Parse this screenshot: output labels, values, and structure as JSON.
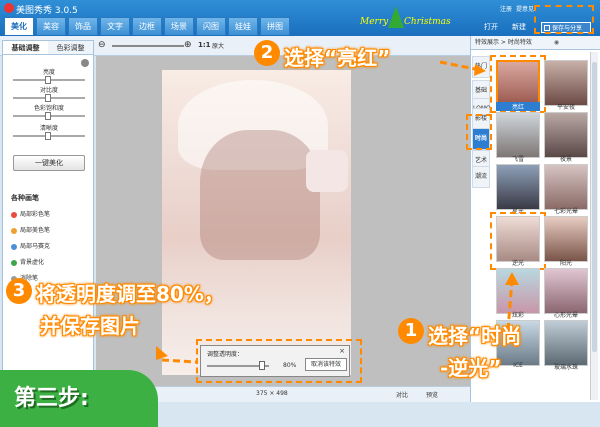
{
  "titlebar": {
    "app_title": "美图秀秀 3.0.5",
    "tabs": [
      "美化",
      "美容",
      "饰品",
      "文字",
      "边框",
      "场景",
      "闪图",
      "娃娃",
      "拼图"
    ],
    "active_tab": "美化",
    "holiday_text_1": "Merry",
    "holiday_text_2": "Christmas",
    "right_links": [
      "注册",
      "提意见"
    ],
    "open_label": "打开",
    "new_label": "新建",
    "save_label": "保存与分享"
  },
  "zoombar": {
    "ratio": "1:1",
    "original_label": "原大"
  },
  "left_panel": {
    "tabs": [
      "基础调整",
      "色彩调整"
    ],
    "sliders": [
      "亮度",
      "对比度",
      "色彩饱和度",
      "清晰度"
    ],
    "one_click": "一键美化",
    "brush_title": "各种画笔",
    "brushes": [
      {
        "label": "局部彩色笔",
        "color": "#e84a3c"
      },
      {
        "label": "局部美色笔",
        "color": "#f0a030"
      },
      {
        "label": "局部马赛克",
        "color": "#4a8fd8"
      },
      {
        "label": "背景虚化",
        "color": "#3aa84a"
      },
      {
        "label": "消除笔",
        "color": "#999999"
      }
    ]
  },
  "status_bar": {
    "size": "375 × 498",
    "compare": "对比",
    "preview": "预览"
  },
  "dialog": {
    "title": "调整透明度：",
    "percent": "80%",
    "cancel": "取消该特效",
    "close": "×"
  },
  "right_panel": {
    "header": "特效展示",
    "breadcrumb": "时尚特效",
    "categories": [
      "热门",
      "基础",
      "LOMO",
      "影楼",
      "时尚",
      "艺术",
      "潮流"
    ],
    "active_category": "时尚",
    "effects": [
      "亮红",
      "平安夜",
      "飞雪",
      "夜景",
      "星光",
      "七彩光晕",
      "逆光",
      "阳光",
      "炫彩",
      "心形光晕",
      "ICE",
      "玻璃水珠"
    ],
    "selected_effect": "亮红"
  },
  "callouts": {
    "step1_num": "1",
    "step1_text_a": "选择“时尚",
    "step1_text_b": "-逆光”",
    "step2_num": "2",
    "step2_text": "选择“亮红”",
    "step3_num": "3",
    "step3_text_a": "将透明度调至80%，",
    "step3_text_b": "并保存图片"
  },
  "step_banner": "第三步:"
}
